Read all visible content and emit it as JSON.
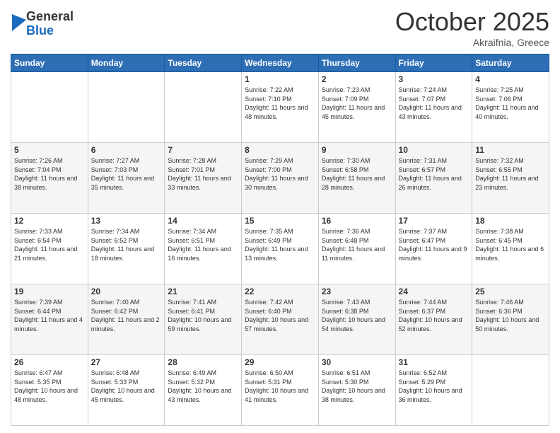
{
  "header": {
    "logo_general": "General",
    "logo_blue": "Blue",
    "month_title": "October 2025",
    "location": "Akraifnia, Greece"
  },
  "days_of_week": [
    "Sunday",
    "Monday",
    "Tuesday",
    "Wednesday",
    "Thursday",
    "Friday",
    "Saturday"
  ],
  "weeks": [
    [
      {
        "num": "",
        "sunrise": "",
        "sunset": "",
        "daylight": ""
      },
      {
        "num": "",
        "sunrise": "",
        "sunset": "",
        "daylight": ""
      },
      {
        "num": "",
        "sunrise": "",
        "sunset": "",
        "daylight": ""
      },
      {
        "num": "1",
        "sunrise": "Sunrise: 7:22 AM",
        "sunset": "Sunset: 7:10 PM",
        "daylight": "Daylight: 11 hours and 48 minutes."
      },
      {
        "num": "2",
        "sunrise": "Sunrise: 7:23 AM",
        "sunset": "Sunset: 7:09 PM",
        "daylight": "Daylight: 11 hours and 45 minutes."
      },
      {
        "num": "3",
        "sunrise": "Sunrise: 7:24 AM",
        "sunset": "Sunset: 7:07 PM",
        "daylight": "Daylight: 11 hours and 43 minutes."
      },
      {
        "num": "4",
        "sunrise": "Sunrise: 7:25 AM",
        "sunset": "Sunset: 7:06 PM",
        "daylight": "Daylight: 11 hours and 40 minutes."
      }
    ],
    [
      {
        "num": "5",
        "sunrise": "Sunrise: 7:26 AM",
        "sunset": "Sunset: 7:04 PM",
        "daylight": "Daylight: 11 hours and 38 minutes."
      },
      {
        "num": "6",
        "sunrise": "Sunrise: 7:27 AM",
        "sunset": "Sunset: 7:03 PM",
        "daylight": "Daylight: 11 hours and 35 minutes."
      },
      {
        "num": "7",
        "sunrise": "Sunrise: 7:28 AM",
        "sunset": "Sunset: 7:01 PM",
        "daylight": "Daylight: 11 hours and 33 minutes."
      },
      {
        "num": "8",
        "sunrise": "Sunrise: 7:29 AM",
        "sunset": "Sunset: 7:00 PM",
        "daylight": "Daylight: 11 hours and 30 minutes."
      },
      {
        "num": "9",
        "sunrise": "Sunrise: 7:30 AM",
        "sunset": "Sunset: 6:58 PM",
        "daylight": "Daylight: 11 hours and 28 minutes."
      },
      {
        "num": "10",
        "sunrise": "Sunrise: 7:31 AM",
        "sunset": "Sunset: 6:57 PM",
        "daylight": "Daylight: 11 hours and 26 minutes."
      },
      {
        "num": "11",
        "sunrise": "Sunrise: 7:32 AM",
        "sunset": "Sunset: 6:55 PM",
        "daylight": "Daylight: 11 hours and 23 minutes."
      }
    ],
    [
      {
        "num": "12",
        "sunrise": "Sunrise: 7:33 AM",
        "sunset": "Sunset: 6:54 PM",
        "daylight": "Daylight: 11 hours and 21 minutes."
      },
      {
        "num": "13",
        "sunrise": "Sunrise: 7:34 AM",
        "sunset": "Sunset: 6:52 PM",
        "daylight": "Daylight: 11 hours and 18 minutes."
      },
      {
        "num": "14",
        "sunrise": "Sunrise: 7:34 AM",
        "sunset": "Sunset: 6:51 PM",
        "daylight": "Daylight: 11 hours and 16 minutes."
      },
      {
        "num": "15",
        "sunrise": "Sunrise: 7:35 AM",
        "sunset": "Sunset: 6:49 PM",
        "daylight": "Daylight: 11 hours and 13 minutes."
      },
      {
        "num": "16",
        "sunrise": "Sunrise: 7:36 AM",
        "sunset": "Sunset: 6:48 PM",
        "daylight": "Daylight: 11 hours and 11 minutes."
      },
      {
        "num": "17",
        "sunrise": "Sunrise: 7:37 AM",
        "sunset": "Sunset: 6:47 PM",
        "daylight": "Daylight: 11 hours and 9 minutes."
      },
      {
        "num": "18",
        "sunrise": "Sunrise: 7:38 AM",
        "sunset": "Sunset: 6:45 PM",
        "daylight": "Daylight: 11 hours and 6 minutes."
      }
    ],
    [
      {
        "num": "19",
        "sunrise": "Sunrise: 7:39 AM",
        "sunset": "Sunset: 6:44 PM",
        "daylight": "Daylight: 11 hours and 4 minutes."
      },
      {
        "num": "20",
        "sunrise": "Sunrise: 7:40 AM",
        "sunset": "Sunset: 6:42 PM",
        "daylight": "Daylight: 11 hours and 2 minutes."
      },
      {
        "num": "21",
        "sunrise": "Sunrise: 7:41 AM",
        "sunset": "Sunset: 6:41 PM",
        "daylight": "Daylight: 10 hours and 59 minutes."
      },
      {
        "num": "22",
        "sunrise": "Sunrise: 7:42 AM",
        "sunset": "Sunset: 6:40 PM",
        "daylight": "Daylight: 10 hours and 57 minutes."
      },
      {
        "num": "23",
        "sunrise": "Sunrise: 7:43 AM",
        "sunset": "Sunset: 6:38 PM",
        "daylight": "Daylight: 10 hours and 54 minutes."
      },
      {
        "num": "24",
        "sunrise": "Sunrise: 7:44 AM",
        "sunset": "Sunset: 6:37 PM",
        "daylight": "Daylight: 10 hours and 52 minutes."
      },
      {
        "num": "25",
        "sunrise": "Sunrise: 7:46 AM",
        "sunset": "Sunset: 6:36 PM",
        "daylight": "Daylight: 10 hours and 50 minutes."
      }
    ],
    [
      {
        "num": "26",
        "sunrise": "Sunrise: 6:47 AM",
        "sunset": "Sunset: 5:35 PM",
        "daylight": "Daylight: 10 hours and 48 minutes."
      },
      {
        "num": "27",
        "sunrise": "Sunrise: 6:48 AM",
        "sunset": "Sunset: 5:33 PM",
        "daylight": "Daylight: 10 hours and 45 minutes."
      },
      {
        "num": "28",
        "sunrise": "Sunrise: 6:49 AM",
        "sunset": "Sunset: 5:32 PM",
        "daylight": "Daylight: 10 hours and 43 minutes."
      },
      {
        "num": "29",
        "sunrise": "Sunrise: 6:50 AM",
        "sunset": "Sunset: 5:31 PM",
        "daylight": "Daylight: 10 hours and 41 minutes."
      },
      {
        "num": "30",
        "sunrise": "Sunrise: 6:51 AM",
        "sunset": "Sunset: 5:30 PM",
        "daylight": "Daylight: 10 hours and 38 minutes."
      },
      {
        "num": "31",
        "sunrise": "Sunrise: 6:52 AM",
        "sunset": "Sunset: 5:29 PM",
        "daylight": "Daylight: 10 hours and 36 minutes."
      },
      {
        "num": "",
        "sunrise": "",
        "sunset": "",
        "daylight": ""
      }
    ]
  ]
}
